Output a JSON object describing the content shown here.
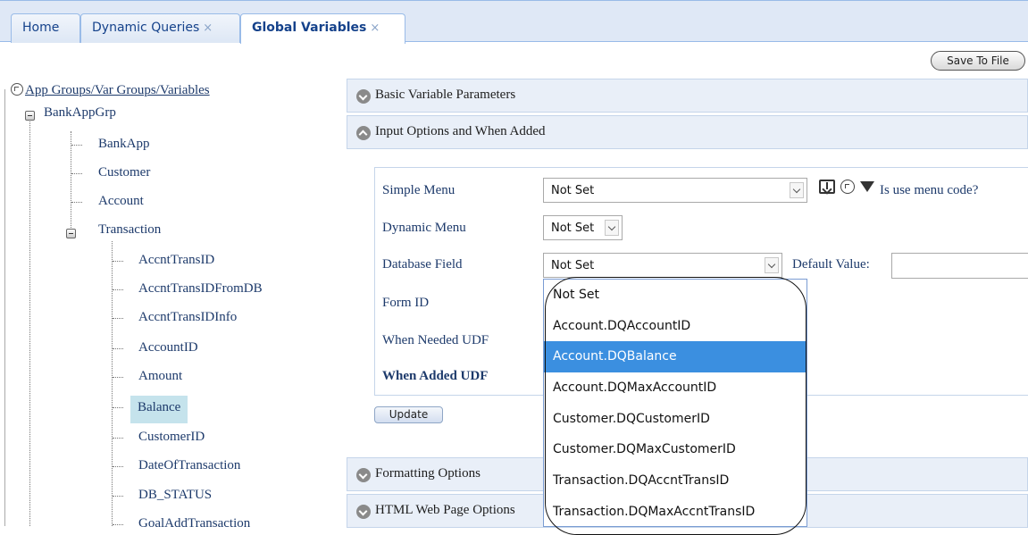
{
  "tabs": [
    {
      "label": "Home",
      "closable": false,
      "active": false
    },
    {
      "label": "Dynamic Queries",
      "closable": true,
      "active": false
    },
    {
      "label": "Global Variables",
      "closable": true,
      "active": true
    }
  ],
  "tab_close_glyph": "×",
  "toolbar": {
    "save_label": "Save To File"
  },
  "tree": {
    "root_label": "App Groups/Var Groups/Variables",
    "group_label": "BankAppGrp",
    "children": [
      "BankApp",
      "Customer",
      "Account",
      "Transaction"
    ],
    "variables": [
      "AccntTransID",
      "AccntTransIDFromDB",
      "AccntTransIDInfo",
      "AccountID",
      "Amount",
      "Balance",
      "CustomerID",
      "DateOfTransaction",
      "DB_STATUS",
      "GoalAddTransaction"
    ],
    "selected": "Balance"
  },
  "panels": {
    "basic": "Basic Variable Parameters",
    "input": "Input Options and When Added",
    "formatting": "Formatting Options",
    "html": "HTML Web Page Options"
  },
  "form": {
    "simple_menu_label": "Simple Menu",
    "simple_menu_value": "Not Set",
    "menu_code_link": "Is use menu code?",
    "dynamic_menu_label": "Dynamic Menu",
    "dynamic_menu_value": "Not Set",
    "database_field_label": "Database Field",
    "database_field_value": "Not Set",
    "default_value_label": "Default Value:",
    "default_value": "",
    "form_id_label": "Form ID",
    "when_needed_label": "When Needed UDF",
    "when_added_label": "When Added UDF",
    "update_label": "Update"
  },
  "dropdown": {
    "options": [
      "Not Set",
      "Account.DQAccountID",
      "Account.DQBalance",
      "Account.DQMaxAccountID",
      "Customer.DQCustomerID",
      "Customer.DQMaxCustomerID",
      "Transaction.DQAccntTransID",
      "Transaction.DQMaxAccntTransID"
    ],
    "highlighted": "Account.DQBalance"
  },
  "colors": {
    "accent": "#3b8fe0",
    "selection": "#c5e3ec",
    "tab_bar": "#dfe8f6"
  },
  "icons": [
    "refresh-icon",
    "download-icon",
    "filter-icon",
    "chevron-down-icon",
    "chevron-up-icon",
    "tree-collapse-icon"
  ]
}
